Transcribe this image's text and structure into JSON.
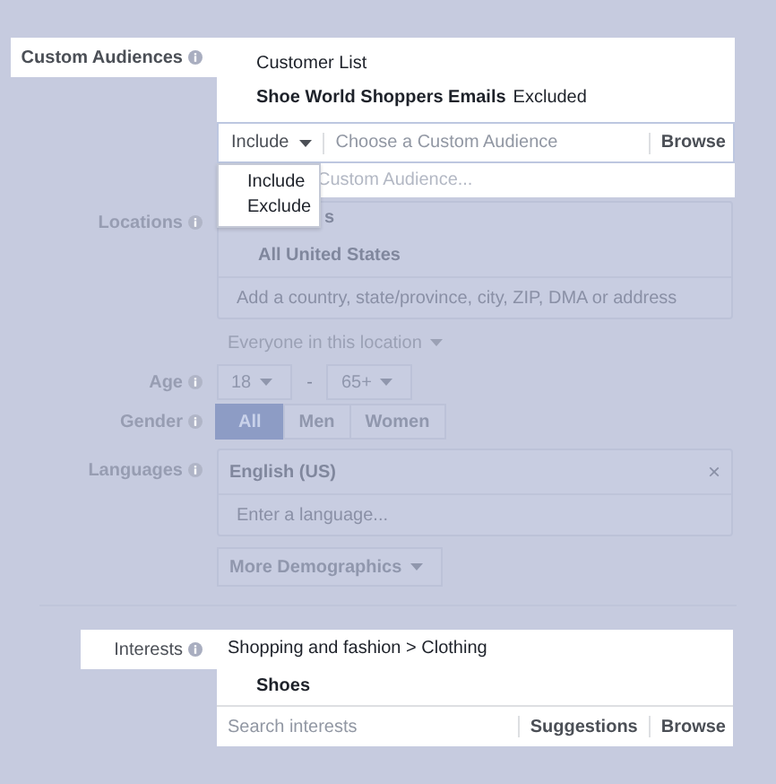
{
  "custom_audiences": {
    "label": "Custom Audiences",
    "list_heading": "Customer List",
    "audiences": [
      {
        "name": "Shoe World Shoppers Emails",
        "status": "Excluded"
      }
    ],
    "mode": "Include",
    "placeholder": "Choose a Custom Audience",
    "browse": "Browse",
    "suggestion": "Custom Audience...",
    "menu": [
      {
        "label": "Include"
      },
      {
        "label": "Exclude"
      }
    ]
  },
  "locations": {
    "label": "Locations",
    "fragment": "s",
    "selected": "All United States",
    "placeholder": "Add a country, state/province, city, ZIP, DMA or address",
    "scope": "Everyone in this location"
  },
  "age": {
    "label": "Age",
    "min": "18",
    "separator": "-",
    "max": "65+"
  },
  "gender": {
    "label": "Gender",
    "options": [
      {
        "label": "All",
        "selected": true
      },
      {
        "label": "Men",
        "selected": false
      },
      {
        "label": "Women",
        "selected": false
      }
    ]
  },
  "languages": {
    "label": "Languages",
    "values": [
      {
        "label": "English (US)",
        "remove": "×"
      }
    ],
    "placeholder": "Enter a language..."
  },
  "more_demographics": "More Demographics",
  "interests": {
    "label": "Interests",
    "category": "Shopping and fashion > Clothing",
    "items": [
      "Shoes"
    ],
    "placeholder": "Search interests",
    "suggestions": "Suggestions",
    "browse": "Browse"
  }
}
